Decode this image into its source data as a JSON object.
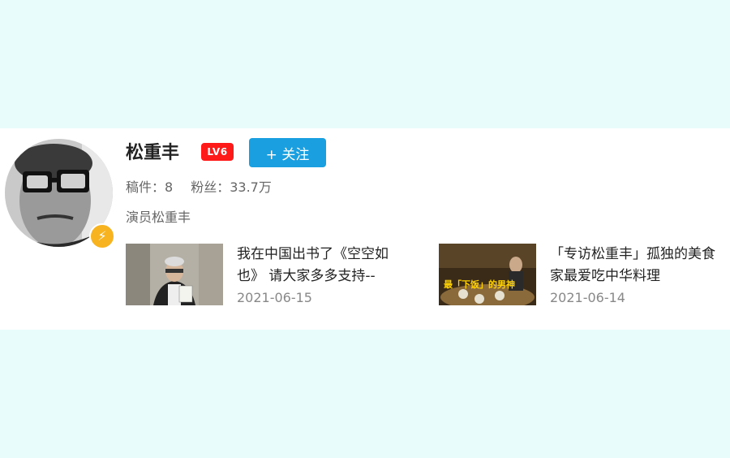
{
  "profile": {
    "name": "松重丰",
    "level": "LV6",
    "follow_label": "+ 关注",
    "posts_label": "稿件：",
    "posts_count": "8",
    "fans_label": "粉丝：",
    "fans_count": "33.7万",
    "bio": "演员松重丰",
    "verified_icon": "lightning-icon"
  },
  "videos": [
    {
      "title": "我在中国出书了《空空如也》 请大家多多支持--",
      "date": "2021-06-15",
      "thumbnail": "man-holding-book-thumbnail"
    },
    {
      "title": "「专访松重丰」孤独的美食家最爱吃中华料理",
      "date": "2021-06-14",
      "thumbnail": "restaurant-table-thumbnail",
      "thumbnail_text": "最「下饭」的男神"
    }
  ],
  "colors": {
    "page_background": "#e8fcfc",
    "follow_button": "#1aa0e0",
    "level_badge": "#ff1a1a",
    "verified_badge": "#f7b320"
  }
}
